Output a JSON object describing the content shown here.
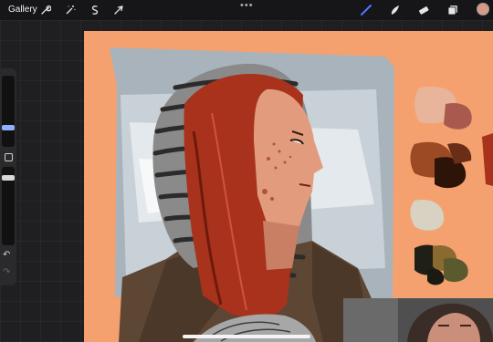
{
  "topbar": {
    "gallery_label": "Gallery",
    "more_dots": "•••"
  },
  "tools_left": [
    "wrench-icon",
    "magic-wand-icon",
    "selection-icon",
    "transform-arrow-icon"
  ],
  "tools_right": [
    "brush-icon",
    "smudge-icon",
    "eraser-icon",
    "layers-icon"
  ],
  "colors": {
    "active_color": "#d69a86",
    "canvas_bg": "#f5a16f",
    "accent_blue": "#4c7bff"
  },
  "palette": [
    "#e8b49a",
    "#a95a4f",
    "#6a2e18",
    "#9b4a24",
    "#2d1409",
    "#d7d2c2",
    "#1f1f16",
    "#8a6a2f",
    "#5a5a2e"
  ]
}
